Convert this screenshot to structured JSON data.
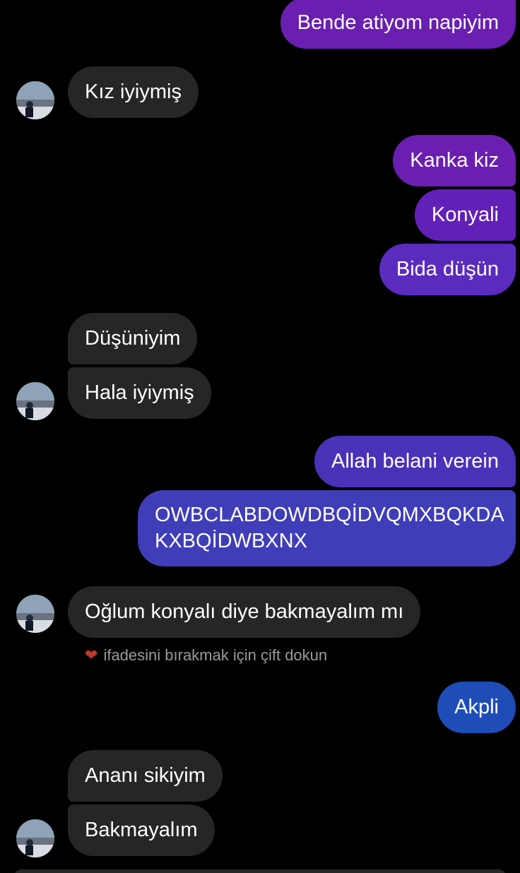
{
  "colors": {
    "background": "#000000",
    "incoming_bubble": "#262626",
    "outgoing_purple": "#6a1fb1",
    "outgoing_violet": "#5b2bc0",
    "outgoing_indigo": "#4a32b8",
    "outgoing_blue": "#1f4db8",
    "heart": "#c0392b"
  },
  "messages": [
    {
      "id": "m1",
      "direction": "out",
      "text": "Bende atiyom napiyim"
    },
    {
      "id": "m2",
      "direction": "in",
      "text": "Kız iyiymiş"
    },
    {
      "id": "m3",
      "direction": "out",
      "text": "Kanka kiz"
    },
    {
      "id": "m4",
      "direction": "out",
      "text": "Konyali"
    },
    {
      "id": "m5",
      "direction": "out",
      "text": "Bida düşün"
    },
    {
      "id": "m6",
      "direction": "in",
      "text": "Düşüniyim"
    },
    {
      "id": "m7",
      "direction": "in",
      "text": "Hala iyiymiş"
    },
    {
      "id": "m8",
      "direction": "out",
      "text": "Allah belani verein"
    },
    {
      "id": "m9",
      "direction": "out",
      "text": "OWBCLABDOWDBQİDVQMXBQKDA KXBQİDWBXNX"
    },
    {
      "id": "m10",
      "direction": "in",
      "text": "Oğlum konyalı diye bakmayalım mı"
    },
    {
      "id": "m11",
      "direction": "out",
      "text": "Akpli"
    },
    {
      "id": "m12",
      "direction": "in",
      "text": "Ananı sikiyim"
    },
    {
      "id": "m13",
      "direction": "in",
      "text": "Bakmayalım"
    }
  ],
  "reaction_hint": {
    "icon": "heart-icon",
    "text": "ifadesini bırakmak için çift dokun"
  }
}
